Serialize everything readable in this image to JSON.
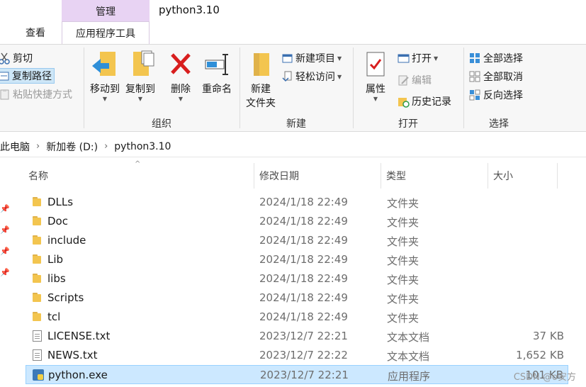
{
  "window": {
    "title": "python3.10",
    "context_group": "管理",
    "tabs": {
      "view": "查看",
      "app_tools": "应用程序工具",
      "edge_fragment": ""
    }
  },
  "ribbon": {
    "clipboard": {
      "cut": "剪切",
      "copy_path": "复制路径",
      "paste_shortcut": "粘贴快捷方式"
    },
    "organize": {
      "label": "组织",
      "move_to": "移动到",
      "copy_to": "复制到",
      "delete": "删除",
      "rename": "重命名"
    },
    "new": {
      "label": "新建",
      "new_folder_line1": "新建",
      "new_folder_line2": "文件夹",
      "new_item": "新建项目",
      "easy_access": "轻松访问"
    },
    "open": {
      "label": "打开",
      "properties": "属性",
      "open": "打开",
      "edit": "编辑",
      "history": "历史记录"
    },
    "select": {
      "label": "选择",
      "select_all": "全部选择",
      "select_none": "全部取消",
      "invert_selection": "反向选择"
    }
  },
  "address": {
    "crumbs": [
      "此电脑",
      "新加卷 (D:)",
      "python3.10"
    ]
  },
  "columns": {
    "name": "名称",
    "date": "修改日期",
    "type": "类型",
    "size": "大小"
  },
  "files": [
    {
      "name": "DLLs",
      "date": "2024/1/18 22:49",
      "type": "文件夹",
      "size": "",
      "icon": "folder-icon"
    },
    {
      "name": "Doc",
      "date": "2024/1/18 22:49",
      "type": "文件夹",
      "size": "",
      "icon": "folder-icon"
    },
    {
      "name": "include",
      "date": "2024/1/18 22:49",
      "type": "文件夹",
      "size": "",
      "icon": "folder-icon"
    },
    {
      "name": "Lib",
      "date": "2024/1/18 22:49",
      "type": "文件夹",
      "size": "",
      "icon": "folder-icon"
    },
    {
      "name": "libs",
      "date": "2024/1/18 22:49",
      "type": "文件夹",
      "size": "",
      "icon": "folder-icon"
    },
    {
      "name": "Scripts",
      "date": "2024/1/18 22:49",
      "type": "文件夹",
      "size": "",
      "icon": "folder-icon"
    },
    {
      "name": "tcl",
      "date": "2024/1/18 22:49",
      "type": "文件夹",
      "size": "",
      "icon": "folder-icon"
    },
    {
      "name": "LICENSE.txt",
      "date": "2023/12/7 22:21",
      "type": "文本文档",
      "size": "37 KB",
      "icon": "text-document-icon"
    },
    {
      "name": "NEWS.txt",
      "date": "2023/12/7 22:22",
      "type": "文本文档",
      "size": "1,652 KB",
      "icon": "text-document-icon"
    },
    {
      "name": "python.exe",
      "date": "2023/12/7 22:21",
      "type": "应用程序",
      "size": "101 KB",
      "icon": "python-exe-icon",
      "selected": true
    }
  ],
  "watermark": "CSDN @o安方",
  "colors": {
    "ribbon_bg": "#f7f7f7",
    "context_tab": "#e8d3f3",
    "selection": "#cce8ff",
    "folder": "#f3c54f"
  }
}
